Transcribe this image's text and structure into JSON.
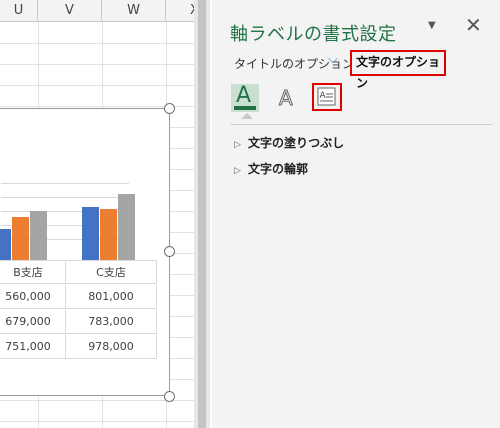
{
  "sheet": {
    "columns": [
      "U",
      "V",
      "W",
      "X"
    ],
    "chart": {
      "table_headers": [
        "B支店",
        "C支店"
      ],
      "table_rows": [
        [
          "560,000",
          "801,000"
        ],
        [
          "679,000",
          "783,000"
        ],
        [
          "751,000",
          "978,000"
        ]
      ],
      "series_colors": [
        "#4472c4",
        "#ed7d31",
        "#a5a5a5"
      ]
    }
  },
  "pane": {
    "title": "軸ラベルの書式設定",
    "menu_icon": "triangle-down-icon",
    "close_label": "✕",
    "tabs": {
      "title_options": "タイトルのオプション",
      "text_options": "文字のオプション"
    },
    "icon_letter": "A",
    "sections": [
      {
        "label": "文字の塗りつぶし"
      },
      {
        "label": "文字の輪郭"
      }
    ],
    "colors": {
      "accent": "#217346",
      "highlight": "#e00000"
    }
  }
}
